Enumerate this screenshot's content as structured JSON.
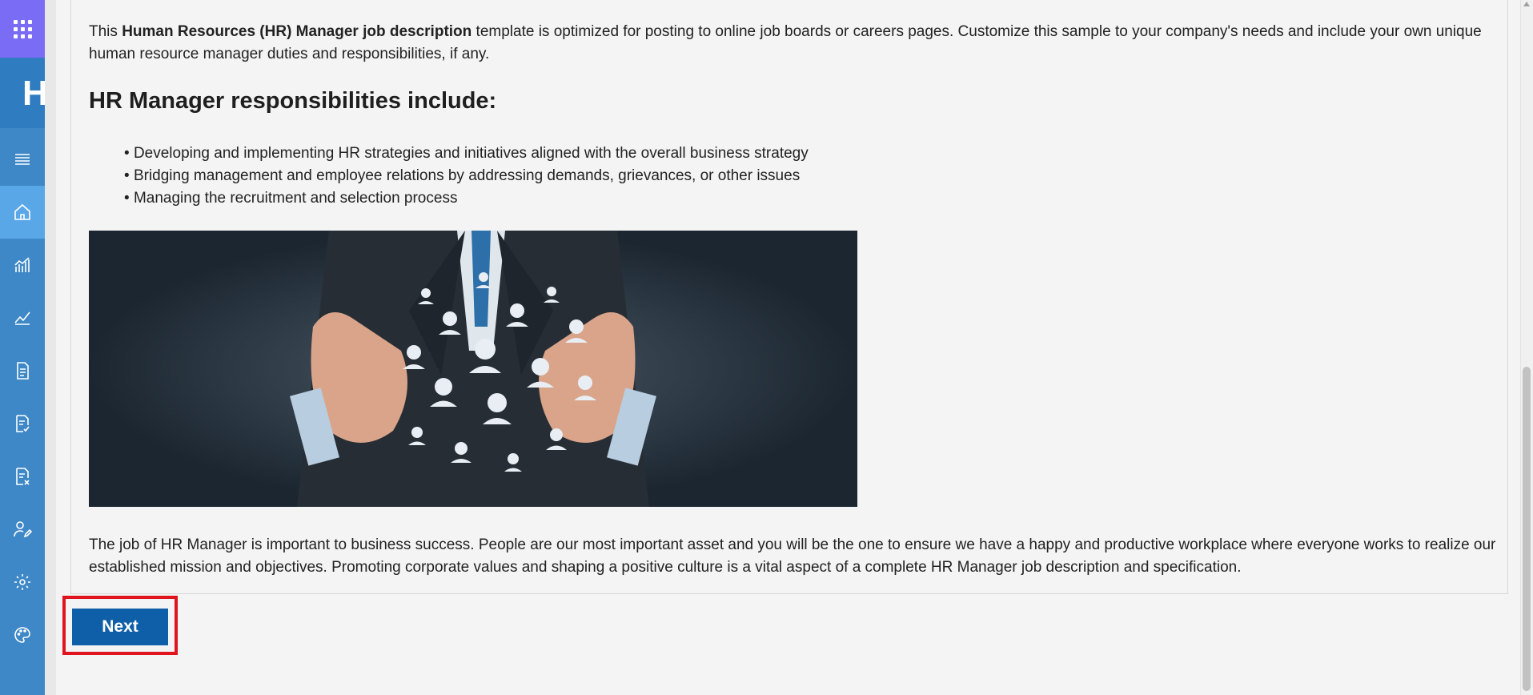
{
  "rail": {
    "header_text": "HI",
    "icons": [
      "menu-icon",
      "home-icon",
      "bar-chart-icon",
      "line-chart-icon",
      "document-icon",
      "checklist-icon",
      "document-remove-icon",
      "person-edit-icon",
      "gear-icon",
      "palette-icon"
    ]
  },
  "content": {
    "intro_prefix": "This ",
    "intro_bold": "Human Resources (HR) Manager job description",
    "intro_suffix": " template is optimized for posting to online job boards or careers pages. Customize this sample to your company's needs and include your own unique human resource manager duties and responsibilities, if any.",
    "heading": "HR Manager responsibilities include:",
    "bullets": [
      "Developing and implementing HR strategies and initiatives aligned with the overall business strategy",
      "Bridging management and employee relations by addressing demands, grievances, or other issues",
      "Managing the recruitment and selection process"
    ],
    "outro": "The job of HR Manager is important to business success. People are our most important asset and you will be the one to ensure we have a happy and productive workplace where everyone works to realize our established mission and objectives. Promoting corporate values and shaping a positive culture is a vital aspect of a complete HR Manager job description and specification."
  },
  "actions": {
    "next_label": "Next"
  },
  "colors": {
    "accent": "#0f5ea8",
    "highlight_border": "#e0141e",
    "rail": "#3e88c7"
  }
}
